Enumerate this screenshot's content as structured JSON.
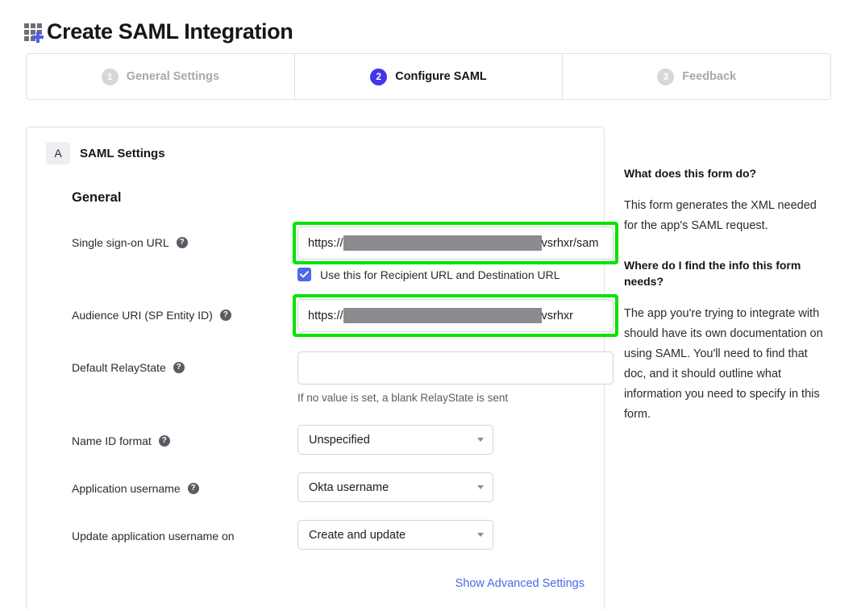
{
  "header": {
    "title": "Create SAML Integration",
    "icon": "app-grid-plus-icon"
  },
  "stepper": {
    "steps": [
      {
        "number": "1",
        "label": "General Settings",
        "active": false
      },
      {
        "number": "2",
        "label": "Configure SAML",
        "active": true
      },
      {
        "number": "3",
        "label": "Feedback",
        "active": false
      }
    ]
  },
  "section": {
    "badge_letter": "A",
    "title": "SAML Settings",
    "group_heading": "General"
  },
  "fields": {
    "sso_url": {
      "label": "Single sign-on URL",
      "help_glyph": "?",
      "value_prefix": "https://",
      "value_suffix": "vsrhxr/sam",
      "redacted": true,
      "highlighted": true
    },
    "recipient_checkbox": {
      "label": "Use this for Recipient URL and Destination URL",
      "checked": true
    },
    "audience_uri": {
      "label": "Audience URI (SP Entity ID)",
      "help_glyph": "?",
      "value_prefix": "https://",
      "value_suffix": "vsrhxr",
      "redacted": true,
      "highlighted": true
    },
    "default_relaystate": {
      "label": "Default RelayState",
      "help_glyph": "?",
      "value": "",
      "placeholder": "",
      "helper_text": "If no value is set, a blank RelayState is sent"
    },
    "name_id_format": {
      "label": "Name ID format",
      "help_glyph": "?",
      "selected": "Unspecified"
    },
    "application_username": {
      "label": "Application username",
      "help_glyph": "?",
      "selected": "Okta username"
    },
    "update_application_username_on": {
      "label": "Update application username on",
      "selected": "Create and update"
    }
  },
  "advanced": {
    "link_label": "Show Advanced Settings"
  },
  "help_panel": {
    "q1_heading": "What does this form do?",
    "q1_body": "This form generates the XML needed for the app's SAML request.",
    "q2_heading": "Where do I find the info this form needs?",
    "q2_body": "The app you're trying to integrate with should have its own documentation on using SAML. You'll need to find that doc, and it should outline what information you need to specify in this form."
  },
  "colors": {
    "accent": "#4436e8",
    "link": "#4b68e8",
    "highlight": "#00e400",
    "redaction": "#8a8a8f"
  }
}
